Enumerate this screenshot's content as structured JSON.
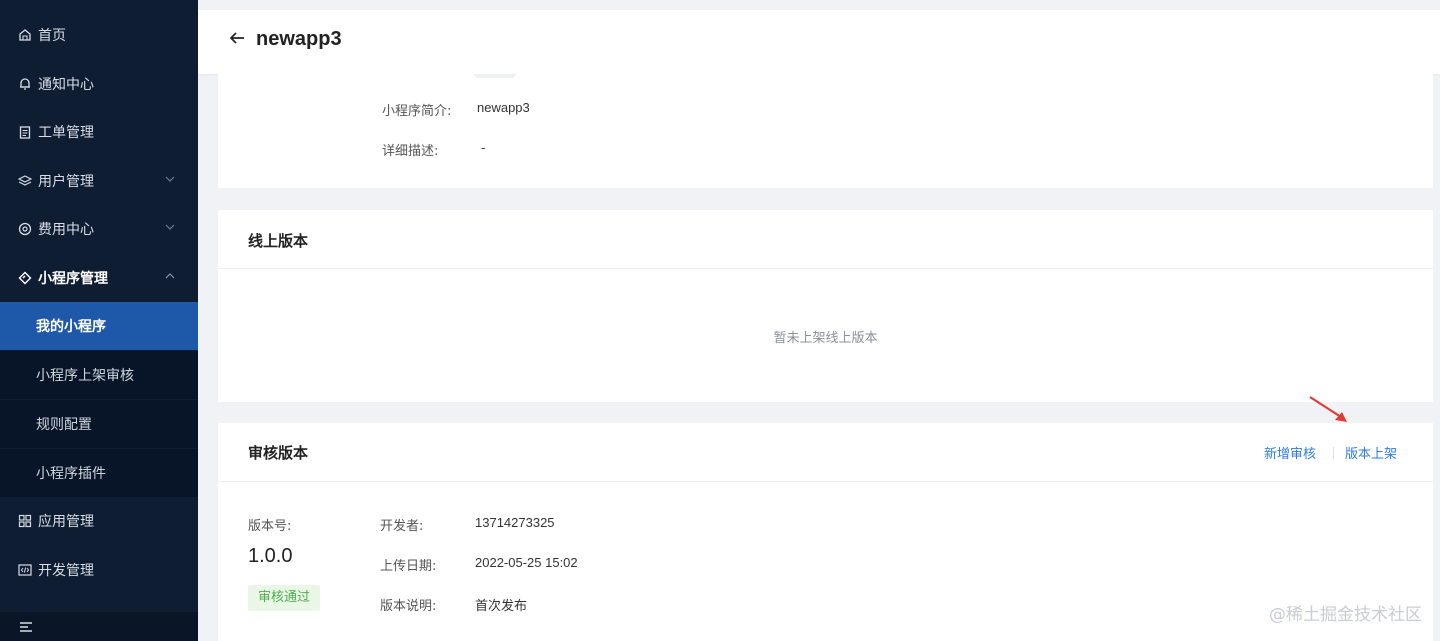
{
  "sidebar": {
    "items": [
      {
        "label": "首页",
        "icon": "home-icon"
      },
      {
        "label": "通知中心",
        "icon": "bell-icon"
      },
      {
        "label": "工单管理",
        "icon": "clipboard-icon"
      },
      {
        "label": "用户管理",
        "icon": "layers-icon"
      },
      {
        "label": "费用中心",
        "icon": "coin-icon"
      },
      {
        "label": "小程序管理",
        "icon": "diamond-icon"
      },
      {
        "label": "应用管理",
        "icon": "grid-icon"
      },
      {
        "label": "开发管理",
        "icon": "code-icon"
      }
    ],
    "sub_items": [
      {
        "label": "我的小程序",
        "active": true
      },
      {
        "label": "小程序上架审核",
        "active": false
      },
      {
        "label": "规则配置",
        "active": false
      },
      {
        "label": "小程序插件",
        "active": false
      }
    ],
    "colors": {
      "background": "#0f1d33",
      "active": "#1e58a8"
    }
  },
  "header": {
    "title": "newapp3"
  },
  "info": {
    "intro_label": "小程序简介:",
    "intro_value": "newapp3",
    "desc_label": "详细描述:",
    "desc_value": "-"
  },
  "online": {
    "title": "线上版本",
    "empty_text": "暂未上架线上版本"
  },
  "review": {
    "title": "审核版本",
    "add_review": "新增审核",
    "publish": "版本上架",
    "version_label": "版本号:",
    "version_value": "1.0.0",
    "status": "审核通过",
    "developer_label": "开发者:",
    "developer_value": "13714273325",
    "upload_label": "上传日期:",
    "upload_value": "2022-05-25 15:02",
    "notes_label": "版本说明:",
    "notes_value": "首次发布"
  },
  "watermark": "@稀土掘金技术社区",
  "colors": {
    "link": "#2f7ce8",
    "status_green": "#4cae4c",
    "arrow_red": "#e53935"
  }
}
